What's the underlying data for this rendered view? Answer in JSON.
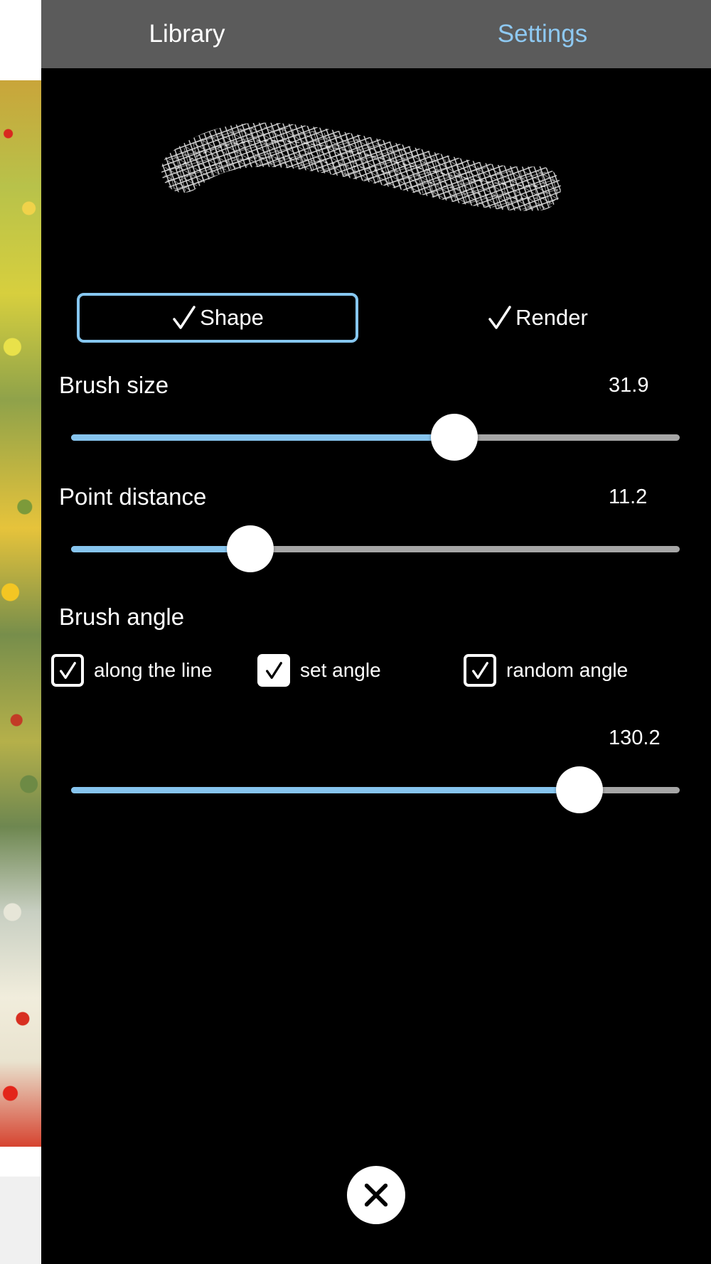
{
  "tabs": {
    "library": "Library",
    "settings": "Settings"
  },
  "modes": {
    "shape": "Shape",
    "render": "Render"
  },
  "brush_size": {
    "label": "Brush size",
    "value": "31.9",
    "fraction": 0.63
  },
  "point_distance": {
    "label": "Point distance",
    "value": "11.2",
    "fraction": 0.294
  },
  "brush_angle": {
    "label": "Brush angle",
    "options": [
      {
        "label": "along the line",
        "checked": true
      },
      {
        "label": "set angle",
        "checked": true
      },
      {
        "label": "random angle",
        "checked": true
      }
    ],
    "value": "130.2",
    "fraction": 0.835
  },
  "colors": {
    "accent": "#86c4ee",
    "tabbar": "#5b5b5b",
    "track": "#a6a6a6"
  },
  "icons": {
    "check": "check-icon",
    "close": "close-icon"
  }
}
